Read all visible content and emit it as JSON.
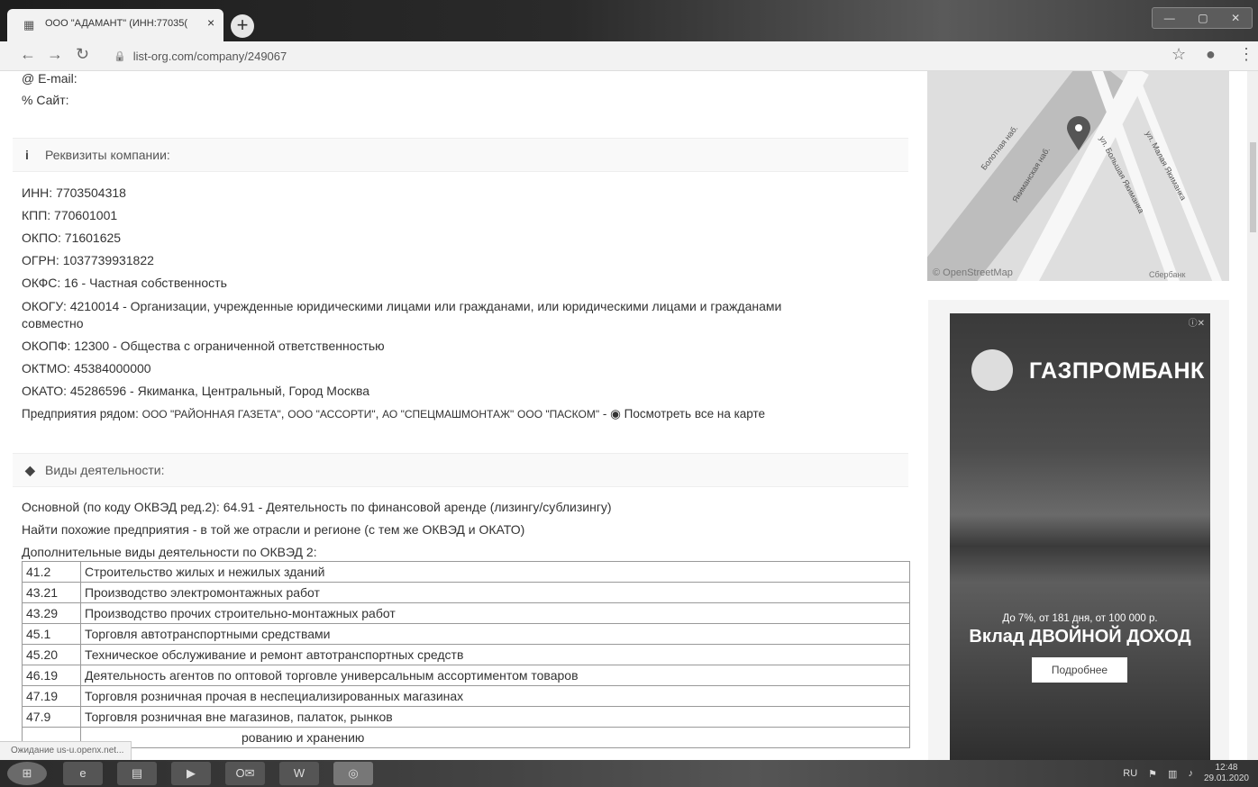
{
  "browser": {
    "tab_title": "ООО \"АДАМАНТ\" (ИНН:77035(",
    "tab_close": "×",
    "new_tab": "+",
    "url": "list-org.com/company/249067",
    "status_text": "Ожидание us-u.openx.net..."
  },
  "contact": {
    "email_label": "E-mail:",
    "site_label": "Сайт:"
  },
  "requisites": {
    "header": "Реквизиты компании:",
    "rows": [
      "ИНН: 7703504318",
      "КПП: 770601001",
      "ОКПО: 71601625",
      "ОГРН: 1037739931822",
      "ОКФС: 16 - Частная собственность",
      "ОКОГУ: 4210014 - Организации, учрежденные юридическими лицами или гражданами, или юридическими лицами и гражданами",
      "совместно",
      "ОКОПФ: 12300 - Общества с ограниченной ответственностью",
      "ОКТМО: 45384000000",
      "ОКАТО: 45286596 - Якиманка, Центральный, Город Москва"
    ],
    "nearby_prefix": "Предприятия рядом:",
    "nearby_links": [
      "ООО \"РАЙОННАЯ ГАЗЕТА\"",
      "ООО \"АССОРТИ\"",
      "АО \"СПЕЦМАШМОНТАЖ\"",
      "ООО \"ПАСКОМ\""
    ],
    "map_link": "Посмотреть все на карте"
  },
  "activities": {
    "header": "Виды деятельности:",
    "main": "Основной (по коду ОКВЭД ред.2): 64.91 - Деятельность по финансовой аренде (лизингу/сублизингу)",
    "similar_link": "Найти похожие предприятия",
    "similar_rest": " - в той же отрасли и регионе (с тем же ОКВЭД и ОКАТО)",
    "additional_label": "Дополнительные виды деятельности по ОКВЭД 2:",
    "table": [
      {
        "code": "41.2",
        "name": "Строительство жилых и нежилых зданий"
      },
      {
        "code": "43.21",
        "name": "Производство электромонтажных работ"
      },
      {
        "code": "43.29",
        "name": "Производство прочих строительно-монтажных работ"
      },
      {
        "code": "45.1",
        "name": "Торговля автотранспортными средствами"
      },
      {
        "code": "45.20",
        "name": "Техническое обслуживание и ремонт автотранспортных средств"
      },
      {
        "code": "46.19",
        "name": "Деятельность агентов по оптовой торговле универсальным ассортиментом товаров"
      },
      {
        "code": "47.19",
        "name": "Торговля розничная прочая в неспециализированных магазинах"
      },
      {
        "code": "47.9",
        "name": "Торговля розничная вне магазинов, палаток, рынков"
      },
      {
        "code": "",
        "name": "рованию и хранению"
      }
    ]
  },
  "map": {
    "streets": [
      "Болотная наб.",
      "Якиманская наб.",
      "ул. Большая Якиманка",
      "ул. Малая Якиманка"
    ],
    "attribution": "© OpenStreetMap",
    "bank_label": "Сбербанк"
  },
  "ad": {
    "brand": "ГАЗПРОМБАНК",
    "offer": "До 7%, от 181 дня, от 100 000 р.",
    "headline": "Вклад ДВОЙНОЙ ДОХОД",
    "button": "Подробнее"
  },
  "taskbar": {
    "language": "RU",
    "time": "12:48",
    "date": "29.01.2020"
  }
}
